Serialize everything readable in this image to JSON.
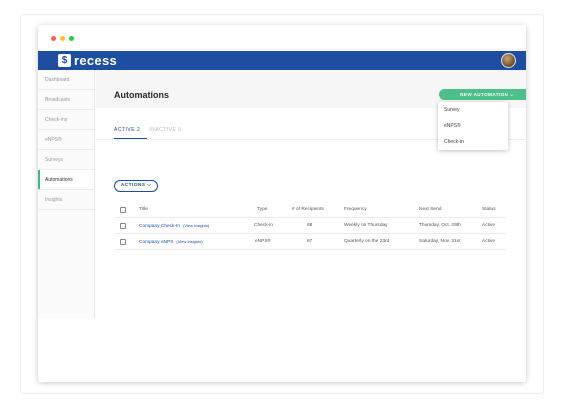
{
  "app": {
    "logo_mark": "$",
    "logo_text": "recess"
  },
  "sidebar": {
    "items": [
      {
        "label": "Dashboard"
      },
      {
        "label": "Broadcasts"
      },
      {
        "label": "Check-ins"
      },
      {
        "label": "eNPS®"
      },
      {
        "label": "Surveys"
      },
      {
        "label": "Automations",
        "active": true
      },
      {
        "label": "Insights"
      }
    ]
  },
  "header": {
    "title": "Automations",
    "new_button": "NEW AUTOMATION ⌵"
  },
  "dropdown": {
    "items": [
      "Survey",
      "eNPS®",
      "Check-in"
    ]
  },
  "tabs": [
    {
      "label": "ACTIVE 2",
      "active": true
    },
    {
      "label": "INACTIVE 0",
      "active": false
    }
  ],
  "actions_button": "ACTIONS ⌵",
  "table": {
    "headers": {
      "title": "Title",
      "type": "Type",
      "recipients": "# of Recipients",
      "frequency": "Frequency",
      "next_send": "Next Send",
      "status": "Status"
    },
    "rows": [
      {
        "title": "Company Check-In",
        "insights": "(View Insights)",
        "type": "Check-in",
        "recipients": "68",
        "frequency": "Weekly on Thursday",
        "next_send": "Thursday, Oct. 29th",
        "status": "Active"
      },
      {
        "title": "Company eNPS",
        "insights": "(View Insights)",
        "type": "eNPS®",
        "recipients": "67",
        "frequency": "Quarterly on the 23rd",
        "next_send": "Saturday, Nov. 21st",
        "status": "Active"
      }
    ]
  },
  "colors": {
    "brand": "#1e4ea0",
    "accent_green": "#4cbf8b"
  }
}
